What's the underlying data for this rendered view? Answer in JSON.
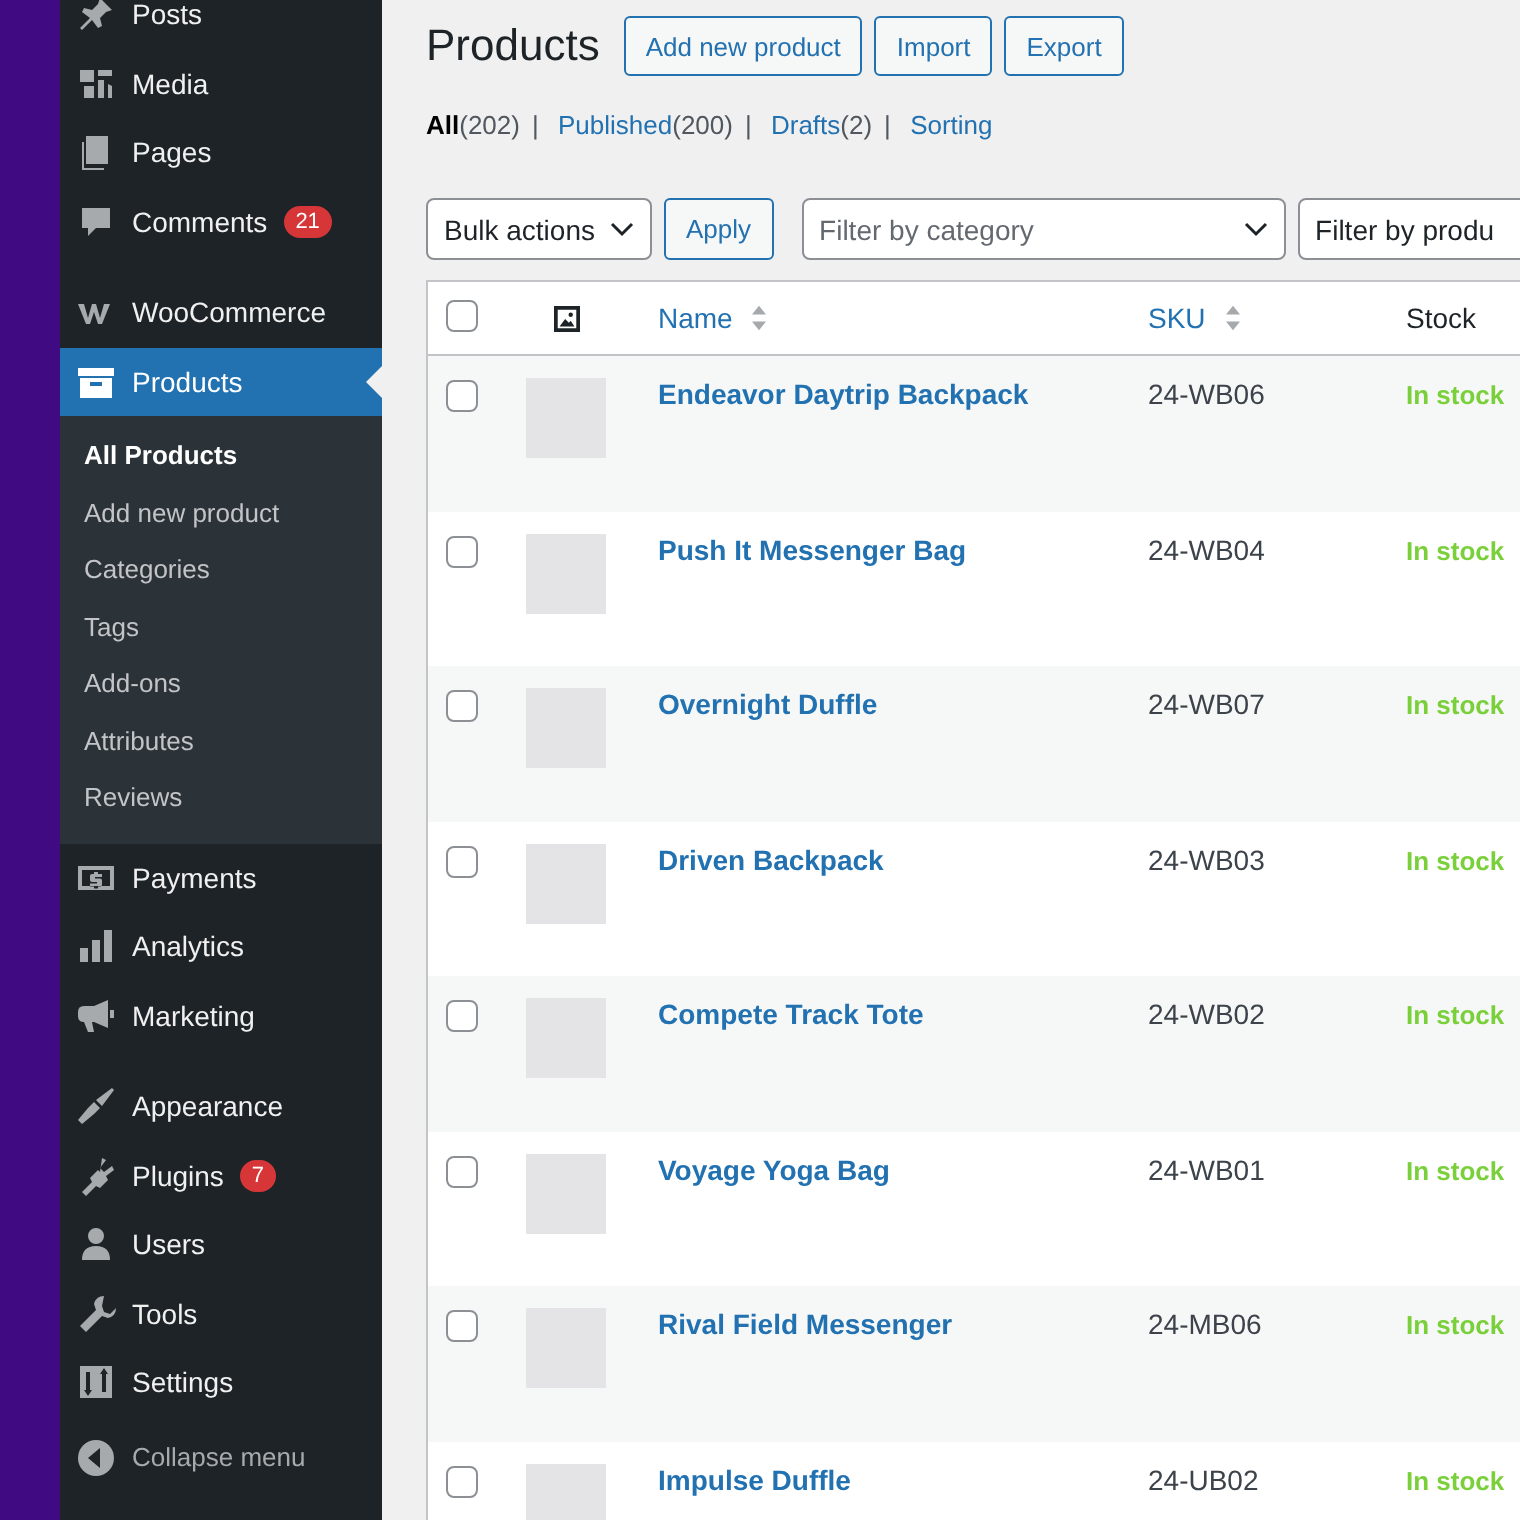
{
  "sidebar": {
    "groups": [
      [
        {
          "label": "Posts",
          "selected": false
        },
        {
          "label": "Media",
          "selected": false
        },
        {
          "label": "Pages",
          "selected": false
        },
        {
          "label": "Comments",
          "badge": "21",
          "selected": false
        }
      ],
      [
        {
          "label": "WooCommerce",
          "selected": false
        },
        {
          "label": "Products",
          "selected": true,
          "children": [
            {
              "label": "All Products",
              "selected": true
            },
            {
              "label": "Add new product",
              "selected": false
            },
            {
              "label": "Categories",
              "selected": false
            },
            {
              "label": "Tags",
              "selected": false
            },
            {
              "label": "Add-ons",
              "selected": false
            },
            {
              "label": "Attributes",
              "selected": false
            },
            {
              "label": "Reviews",
              "selected": false
            }
          ]
        },
        {
          "label": "Payments",
          "selected": false
        },
        {
          "label": "Analytics",
          "selected": false
        },
        {
          "label": "Marketing",
          "selected": false
        }
      ],
      [
        {
          "label": "Appearance",
          "selected": false
        },
        {
          "label": "Plugins",
          "badge": "7",
          "selected": false
        },
        {
          "label": "Users",
          "selected": false
        },
        {
          "label": "Tools",
          "selected": false
        },
        {
          "label": "Settings",
          "selected": false
        }
      ]
    ],
    "collapse": "Collapse menu"
  },
  "page": {
    "title": "Products",
    "actions": [
      "Add new product",
      "Import",
      "Export"
    ],
    "views": [
      {
        "label": "All",
        "count": "(202)",
        "selected": true
      },
      {
        "separator": "|",
        "label": "Published",
        "count": "(200)",
        "selected": false
      },
      {
        "separator": "|",
        "label": "Drafts",
        "count": "(2)",
        "selected": false
      },
      {
        "separator": "|",
        "label": "Sorting",
        "selected": false
      }
    ],
    "bulk_actions": "Bulk actions",
    "apply": "Apply",
    "category_filter": {
      "placeholder": "Filter by category"
    },
    "type_filter": "Filter by produ"
  },
  "table": {
    "select_all_checked": false,
    "columns": [
      {
        "label": "Name",
        "sortable": true
      },
      {
        "label": "SKU",
        "sortable": true
      },
      {
        "label": "Stock",
        "sortable": false
      }
    ],
    "rows": [
      {
        "name": "Endeavor Daytrip Backpack",
        "sku": "24-WB06",
        "stock": "In stock",
        "checked": false
      },
      {
        "name": "Push It Messenger Bag",
        "sku": "24-WB04",
        "stock": "In stock",
        "checked": false
      },
      {
        "name": "Overnight Duffle",
        "sku": "24-WB07",
        "stock": "In stock",
        "checked": false
      },
      {
        "name": "Driven Backpack",
        "sku": "24-WB03",
        "stock": "In stock",
        "checked": false
      },
      {
        "name": "Compete Track Tote",
        "sku": "24-WB02",
        "stock": "In stock",
        "checked": false
      },
      {
        "name": "Voyage Yoga Bag",
        "sku": "24-WB01",
        "stock": "In stock",
        "checked": false
      },
      {
        "name": "Rival Field Messenger",
        "sku": "24-MB06",
        "stock": "In stock",
        "checked": false
      },
      {
        "name": "Impulse Duffle",
        "sku": "24-UB02",
        "stock": "In stock",
        "checked": false
      }
    ]
  }
}
